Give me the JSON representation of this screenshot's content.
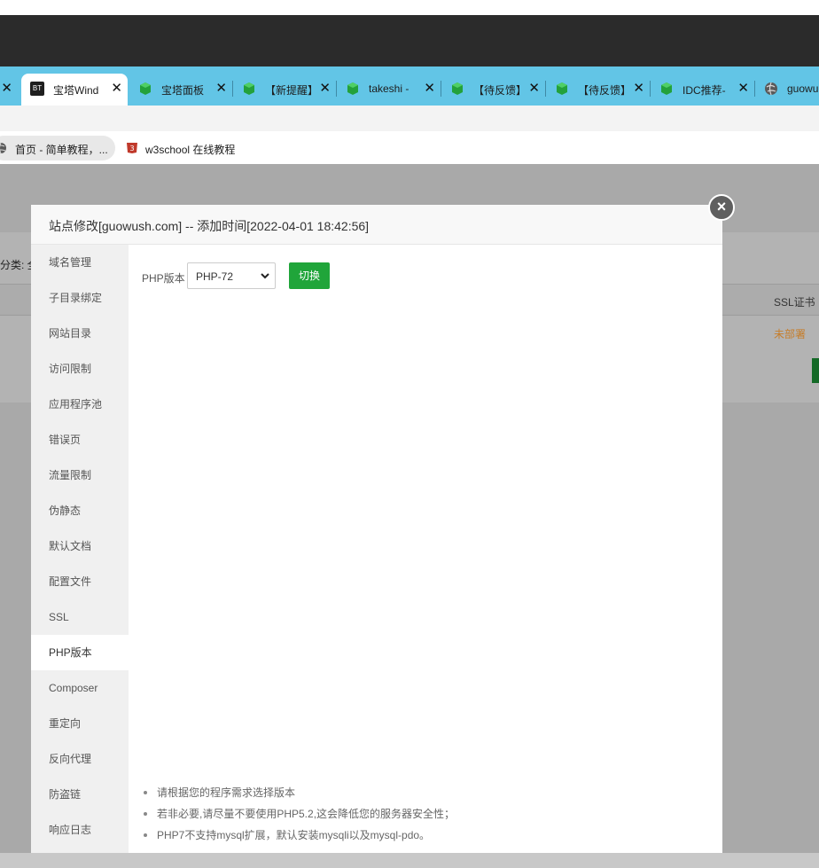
{
  "browser": {
    "tabs": [
      {
        "label": "",
        "close": "✕",
        "icon": "close-icon"
      },
      {
        "label": "宝塔Wind",
        "close": "✕",
        "favicon": "BT",
        "active": true
      },
      {
        "label": "宝塔面板",
        "close": "✕",
        "favicon": "green-cube-icon"
      },
      {
        "label": "【新提醒】",
        "close": "✕",
        "favicon": "green-cube-icon"
      },
      {
        "label": "takeshi -",
        "close": "✕",
        "favicon": "green-cube-icon"
      },
      {
        "label": "【待反馈】",
        "close": "✕",
        "favicon": "green-cube-icon"
      },
      {
        "label": "【待反馈】",
        "close": "✕",
        "favicon": "green-cube-icon"
      },
      {
        "label": "IDC推荐-",
        "close": "✕",
        "favicon": "green-cube-icon"
      },
      {
        "label": "guowu",
        "favicon": "globe-icon"
      }
    ],
    "bookmarks": [
      {
        "label": "首页 - 简单教程，..."
      },
      {
        "label": "w3school 在线教程"
      }
    ]
  },
  "background": {
    "category_label": "分类: 全",
    "ssl_header": "SSL证书",
    "ssl_value": "未部署"
  },
  "modal": {
    "title": "站点修改[guowush.com] -- 添加时间[2022-04-01 18:42:56]",
    "close_label": "×",
    "menu": [
      "域名管理",
      "子目录绑定",
      "网站目录",
      "访问限制",
      "应用程序池",
      "错误页",
      "流量限制",
      "伪静态",
      "默认文档",
      "配置文件",
      "SSL",
      "PHP版本",
      "Composer",
      "重定向",
      "反向代理",
      "防盗链",
      "响应日志"
    ],
    "active_menu": "PHP版本",
    "php_label": "PHP版本",
    "php_selected": "PHP-72",
    "switch_button": "切换",
    "tips": [
      "请根据您的程序需求选择版本",
      "若非必要,请尽量不要使用PHP5.2,这会降低您的服务器安全性；",
      "PHP7不支持mysql扩展，默认安装mysqli以及mysql-pdo。"
    ]
  },
  "colors": {
    "accent_green": "#20a53a",
    "tabstrip": "#62c5e6",
    "ssl_status": "#c67d2a"
  }
}
